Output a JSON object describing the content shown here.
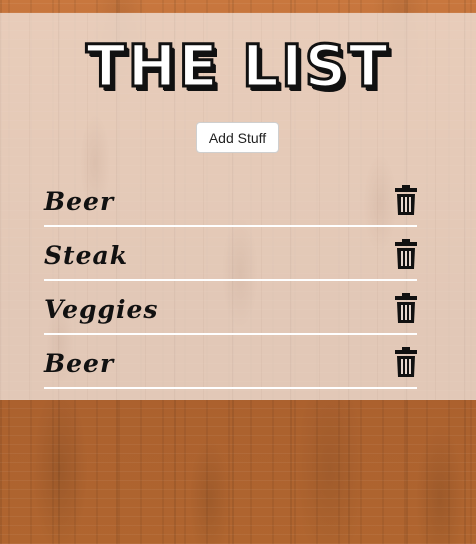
{
  "app": {
    "title": "THE LIST",
    "add_button_label": "Add Stuff"
  },
  "list": {
    "items": [
      {
        "label": "Beer",
        "icon": "trash-icon"
      },
      {
        "label": "Steak",
        "icon": "trash-icon"
      },
      {
        "label": "Veggies",
        "icon": "trash-icon"
      },
      {
        "label": "Beer",
        "icon": "trash-icon"
      }
    ]
  },
  "colors": {
    "panel": "#f0e2da",
    "text": "#111111",
    "divider": "#ffffff",
    "wood": "#b96a33"
  }
}
